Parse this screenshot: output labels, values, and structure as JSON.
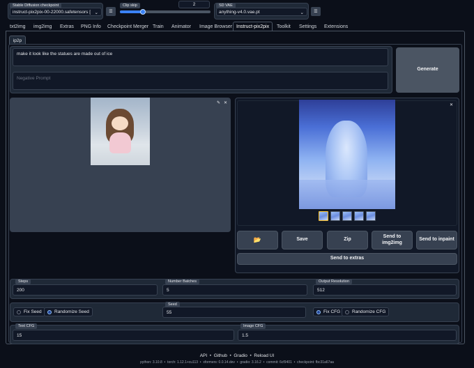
{
  "top": {
    "checkpoint_label": "Stable Diffusion checkpoint",
    "checkpoint_value": "instruct-pix2pix-00-22000.safetensors [fbc31a67a]",
    "clip_skip_label": "Clip skip",
    "clip_skip_value": "2",
    "clip_skip_fraction": 0.25,
    "vae_label": "SD VAE",
    "vae_value": "anything-v4.0.vae.pt"
  },
  "tabs": [
    "txt2img",
    "img2img",
    "Extras",
    "PNG Info",
    "Checkpoint Merger",
    "Train",
    "Animator",
    "Image Browser",
    "Instruct-pix2pix",
    "Toolkit",
    "Settings",
    "Extensions"
  ],
  "active_tab": "Instruct-pix2pix",
  "subtab": "ip2p",
  "prompt": {
    "value": "make it look like the statues are made out of ice",
    "negative_placeholder": "Negative Prompt"
  },
  "generate_label": "Generate",
  "actions": {
    "folder": "📂",
    "save": "Save",
    "zip": "Zip",
    "send_img2img": "Send to img2img",
    "send_inpaint": "Send to inpaint",
    "send_extras": "Send to extras"
  },
  "steps": {
    "label": "Steps",
    "value": "200"
  },
  "batches": {
    "label": "Number Batches",
    "value": "5"
  },
  "resolution": {
    "label": "Output Resolution",
    "value": "512"
  },
  "seed": {
    "fix_seed": "Fix Seed",
    "randomize_seed": "Randomize Seed",
    "label": "Seed",
    "value": "55",
    "fix_cfg": "Fix CFG",
    "randomize_cfg": "Randomize CFG"
  },
  "text_cfg": {
    "label": "Text CFG",
    "value": "15"
  },
  "image_cfg": {
    "label": "Image CFG",
    "value": "1.5"
  },
  "footer": {
    "links": [
      "API",
      "Github",
      "Gradio",
      "Reload UI"
    ],
    "version": "python: 3.10.8  •  torch: 1.12.1+cu113  •  xformers: 0.0.14.dev  •  gradio: 3.16.2  •  commit: 6cf9401  •  checkpoint: fbc31a67aa"
  },
  "colors": {
    "bg": "#0b0f19",
    "panel": "#1f2937",
    "accent": "#3b82f6"
  }
}
